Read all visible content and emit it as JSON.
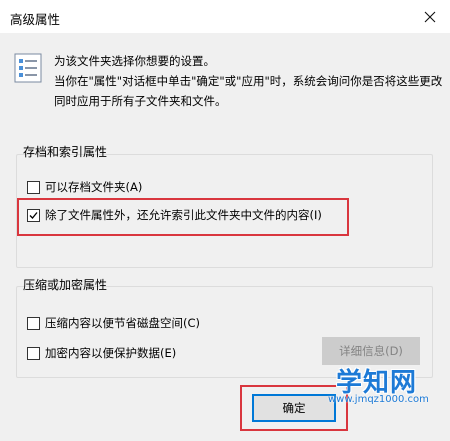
{
  "window": {
    "title": "高级属性"
  },
  "intro": {
    "line1": "为该文件夹选择你想要的设置。",
    "line2": "当你在\"属性\"对话框中单击\"确定\"或\"应用\"时，系统会询问你是否将这些更改同时应用于所有子文件夹和文件。"
  },
  "archive_group": {
    "title": "存档和索引属性",
    "archive_label": "可以存档文件夹(A)",
    "archive_checked": false,
    "index_label": "除了文件属性外，还允许索引此文件夹中文件的内容(I)",
    "index_checked": true
  },
  "compress_group": {
    "title": "压缩或加密属性",
    "compress_label": "压缩内容以便节省磁盘空间(C)",
    "compress_checked": false,
    "encrypt_label": "加密内容以便保护数据(E)",
    "encrypt_checked": false,
    "details_button": "详细信息(D)"
  },
  "buttons": {
    "ok": "确定"
  },
  "watermark": {
    "brand": "学知网",
    "url": "www.jmqz1000.com"
  },
  "colors": {
    "highlight": "#d9363e",
    "accent": "#0078d7"
  },
  "icons": {
    "window_close": "close-icon",
    "settings": "settings-list-icon",
    "check": "checkmark-icon"
  }
}
